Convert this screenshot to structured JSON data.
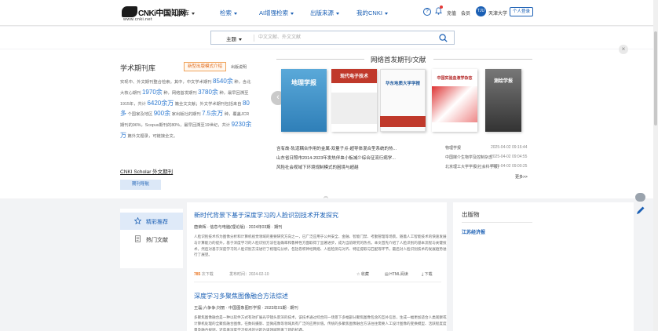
{
  "header": {
    "logo_text": "CNKi中国知网",
    "logo_url": "www.cnki.net",
    "home_menu": "总库",
    "nav": [
      "检索",
      "AI增强检索",
      "出版来源",
      "我的CNKI"
    ],
    "links": [
      "充值",
      "会员"
    ],
    "org": "天津大学",
    "login": "个人登录"
  },
  "search": {
    "scope": "主题",
    "placeholder": "中文文献、外文文献"
  },
  "library": {
    "title": "学术期刊库",
    "model_button": "新型出版模式介绍",
    "model_note": "出版说明",
    "desc_parts": [
      "实现中、外文期刊整合检索。其中，中文学术期刊 ",
      "8540余",
      " 种，含北大核心期刊 ",
      "1970余",
      " 种，网络首发期刊 ",
      "3780余",
      " 种，最早回溯至1915年，共计 ",
      "6420余万",
      " 篇全文文献；外文学术期刊包括来自 ",
      "80多",
      " 个国家及地区 ",
      "900余",
      " 家出版社的期刊 ",
      "7.5余万",
      " 种，覆盖JCR期刊的96%，Scopus期刊的80%，最早回溯至19世纪，共计 ",
      "9230余万",
      " 篇外文题录，可链接全文。"
    ],
    "scholar_link": "CNKI Scholar 外文期刊",
    "guide_button": "期刊导航"
  },
  "network": {
    "title": "网络首发期刊/文献",
    "covers": [
      {
        "title": "地理学报",
        "color": "#2f7fb8"
      },
      {
        "title": "现代电子技术",
        "color": "#c0392b"
      },
      {
        "title": "华东地质大学学报",
        "color": "#1f5a9e"
      },
      {
        "title": "中国实验血液学杂志",
        "color": "#b22222"
      },
      {
        "title": "测绘学报",
        "color": "#4a4a4a"
      }
    ],
    "news": [
      {
        "title": "含有故-轨道耦合作用的金属-双量子点-超导体混合型系统的热...",
        "source": "物理学报",
        "date": "2025-04-02 09:16:44"
      },
      {
        "title": "山东省日照市2014-2023年发热伴血小板减少综合征流行病学...",
        "source": "中国媒介生物学及控制杂志",
        "date": "2025-04-02 09:04:55"
      },
      {
        "title": "风险社会视域下环境规制模式的困境与超越",
        "source": "北京理工大学学报(社会科学版)",
        "date": "2025-04-02 09:00:25"
      }
    ],
    "more": "更多>>"
  },
  "tabs": [
    "精彩推荐",
    "热门文献"
  ],
  "articles": [
    {
      "title": "新时代背景下基于深度学习的人脸识别技术开发探究",
      "author": "唐荣辉",
      "journal": "信息与电脑(理论版)",
      "issue": "2024年03期",
      "type": "期刊",
      "abstract": "人脸识别技术作为图像分析和计算机视觉领域的重要研究方向之一，已广泛应用于公共安全、金融、智能门禁、考勤管理等场景。随着人工智能技术的快速发展与计算能力的提升，基于深度学习的人脸识别方法在准确率和鲁棒性方面取得了显著进步，成为当前研究的热点。本文首先介绍了人脸识别的基本流程与关键技术，然后对基于深度学习的人脸识别方法进行了梳理与分析，包括卷积神经网络、人脸检测与对齐、特征提取与匹配等环节，最后对人脸识别技术的发展趋势进行了展望。",
      "downloads": "785",
      "downloads_label": "次下载",
      "pubtime": "发布时间：2024-02-10",
      "actions": [
        "收藏",
        "HTML阅读",
        "下载"
      ]
    },
    {
      "title": "深度学习多聚焦图像融合方法综述",
      "author": "王磊;六争争;刘丽",
      "journal": "中国图象图形学报",
      "issue": "2023年01期",
      "type": "期刊",
      "abstract": "多聚焦图像融合是一种以软件方式有效扩展光学镜头景深的技术，该技术通过综合同一场景下多幅部分聚焦图像包含的互补信息，生成一幅更加适合人类观察或计算机处理的全聚焦融合图像，在数码摄影、显微成像等领域具有广泛的应用价值。传统的多聚焦图像融合方法往往需要人工设计图像的变换模型、活跃程度度量及融合规则，近年来深度学习技术的兴起为该领域带来了新的机遇。",
      "downloads": "",
      "downloads_label": "",
      "pubtime": "",
      "actions": []
    }
  ],
  "publications": {
    "heading": "出版物",
    "items": [
      "江苏经济报"
    ]
  },
  "colors": {
    "accent": "#1a5fb4",
    "highlight": "#2e7ad1",
    "orange": "#e8711c"
  }
}
